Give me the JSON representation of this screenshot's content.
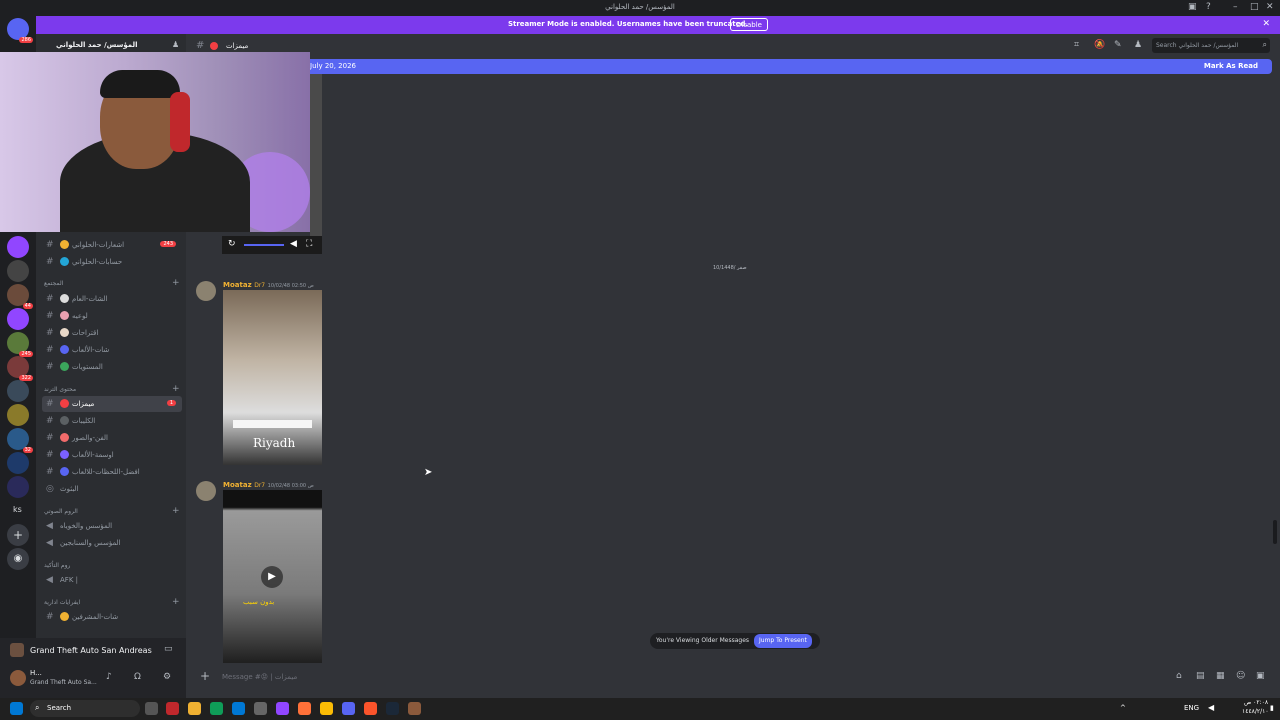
{
  "window": {
    "title": "المؤسس/ حمد الحلواني"
  },
  "banner": {
    "text": "Streamer Mode is enabled. Usernames have been truncated.",
    "disable_label": "Disable"
  },
  "guild": {
    "name": "المؤسس/ حمد الحلواني"
  },
  "channel_header": {
    "name": "ميمزات",
    "search_placeholder": "Search المؤسس/ حمد الحلواني"
  },
  "new_bar": {
    "date": "July 20, 2026",
    "mark_read": "Mark As Read"
  },
  "server_badges": [
    "286",
    "44",
    "245",
    "322",
    "32"
  ],
  "server_text": "ks",
  "channels": {
    "top": [
      {
        "name": "اشعارات-الحلواني",
        "count": "243",
        "color": "#f0b132"
      },
      {
        "name": "حسابات-الحلواني",
        "count": "",
        "color": "#23a5d6"
      }
    ],
    "cat1": "المجتمع",
    "cat1_items": [
      {
        "name": "الشات-العام",
        "color": "#dcdcdc"
      },
      {
        "name": "لوعيه",
        "color": "#e9a0b0"
      },
      {
        "name": "اقتراحات",
        "color": "#e8d8c8"
      },
      {
        "name": "شات-الألعاب",
        "color": "#5865f2"
      },
      {
        "name": "المستويات",
        "color": "#3ba55c"
      }
    ],
    "cat2": "محتوى الترند",
    "cat2_items": [
      {
        "name": "ميمزات",
        "count": "1",
        "color": "#f23f43",
        "selected": true
      },
      {
        "name": "الكليبات",
        "count": "",
        "color": "#5b6063"
      },
      {
        "name": "الفن-والصور",
        "count": "",
        "color": "#f26b6b"
      },
      {
        "name": "اوسمة-الألعاب",
        "count": "",
        "color": "#7b61ff"
      },
      {
        "name": "افضل-اللحظات-للالعاب",
        "count": "",
        "color": "#5865f2"
      }
    ],
    "locked": "البثوث",
    "cat3": "الروم الصوتي",
    "voice1": [
      {
        "name": "المؤسس والخوياه"
      },
      {
        "name": "المؤسس والسنابجين"
      }
    ],
    "cat4": "روم التأكيد",
    "voice2": [
      {
        "name": "AFK |"
      }
    ],
    "cat5": "ايفرايات ادارية",
    "cat5_items": [
      {
        "name": "شات-المشرفين"
      }
    ]
  },
  "messages": [
    {
      "author": "Moataz",
      "tag": "Dr7",
      "time": "10/02/48 02:50 ص"
    },
    {
      "author": "Moataz",
      "tag": "Dr7",
      "time": "10/02/48 03:00 ص"
    }
  ],
  "video_overlay": {
    "logo": "Riyadh",
    "caption": "بدون سبب"
  },
  "center_note": "10/1448/ صفر",
  "older_bar": {
    "text": "You're Viewing Older Messages",
    "jump": "Jump To Present"
  },
  "composer": {
    "placeholder": "Message #😡 | ميمزات"
  },
  "activity": {
    "game": "Grand Theft Auto San Andreas"
  },
  "user": {
    "name": "H...",
    "status": "Grand Theft Auto Sa..."
  },
  "taskbar": {
    "search": "Search",
    "lang": "ENG",
    "time": "٠٢:٠٨ ص",
    "date": "١٤٤٨/٢/١٠"
  }
}
